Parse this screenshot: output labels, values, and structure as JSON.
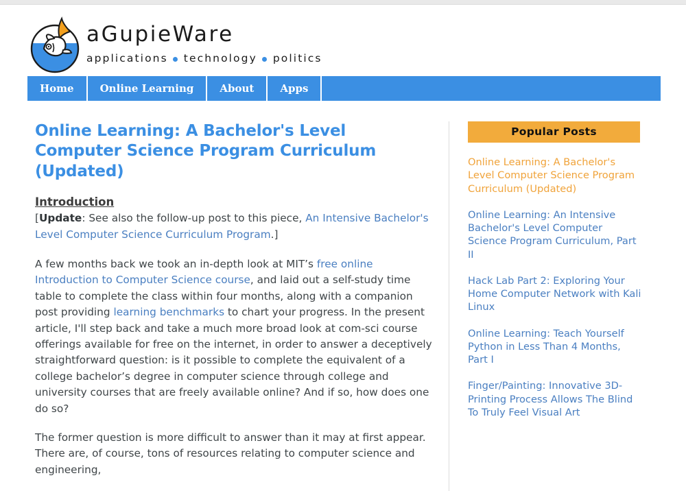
{
  "site": {
    "brand_name": "aGupieWare",
    "tagline_parts": [
      "applications",
      "technology",
      "politics"
    ],
    "logo_icon": "fish-in-bowl-logo",
    "accent_blue": "#3b8fe3",
    "accent_orange": "#f2ab3c",
    "link_blue": "#4a7fc1"
  },
  "nav": {
    "items": [
      {
        "label": "Home"
      },
      {
        "label": "Online Learning"
      },
      {
        "label": "About"
      },
      {
        "label": "Apps"
      }
    ]
  },
  "post": {
    "title": "Online Learning: A Bachelor's Level Computer Science Program Curriculum (Updated)",
    "section_heading": "Introduction ",
    "update_bracket_open": "[",
    "update_label": "Update",
    "update_text_1": ": See also the follow-up post to this piece, ",
    "update_link": "An Intensive Bachelor's Level Computer Science Curriculum Program",
    "update_text_2": ".]",
    "para1_a": "A few months back we took an in-depth look at MIT’s ",
    "para1_link1": "free online Introduction to Computer Science course",
    "para1_b": ", and laid out a self-study time table to complete the class within four months, along with a companion post providing ",
    "para1_link2": "learning benchmarks",
    "para1_c": " to chart your progress. In the present article, I'll step back and take a much more broad look at com-sci course offerings available for free on the internet, in order to answer a deceptively straightforward question: is it possible to complete the equivalent of a college bachelor’s degree in computer science through college and university courses that are freely available online? And if so, how does one do so?",
    "para2": "The former question is more difficult to answer than it may at first appear. There are, of course, tons of resources relating to computer science and engineering,"
  },
  "sidebar": {
    "popular_title": "Popular Posts",
    "popular_posts": [
      {
        "label": "Online Learning: A Bachelor's Level Computer Science Program Curriculum (Updated)",
        "current": true
      },
      {
        "label": "Online Learning: An Intensive Bachelor's Level Computer Science Program Curriculum, Part II",
        "current": false
      },
      {
        "label": "Hack Lab Part 2: Exploring Your Home Computer Network with Kali Linux",
        "current": false
      },
      {
        "label": "Online Learning: Teach Yourself Python in Less Than 4 Months, Part I",
        "current": false
      },
      {
        "label": "Finger/Painting: Innovative 3D-Printing Process Allows The Blind To Truly Feel Visual Art",
        "current": false
      }
    ]
  }
}
